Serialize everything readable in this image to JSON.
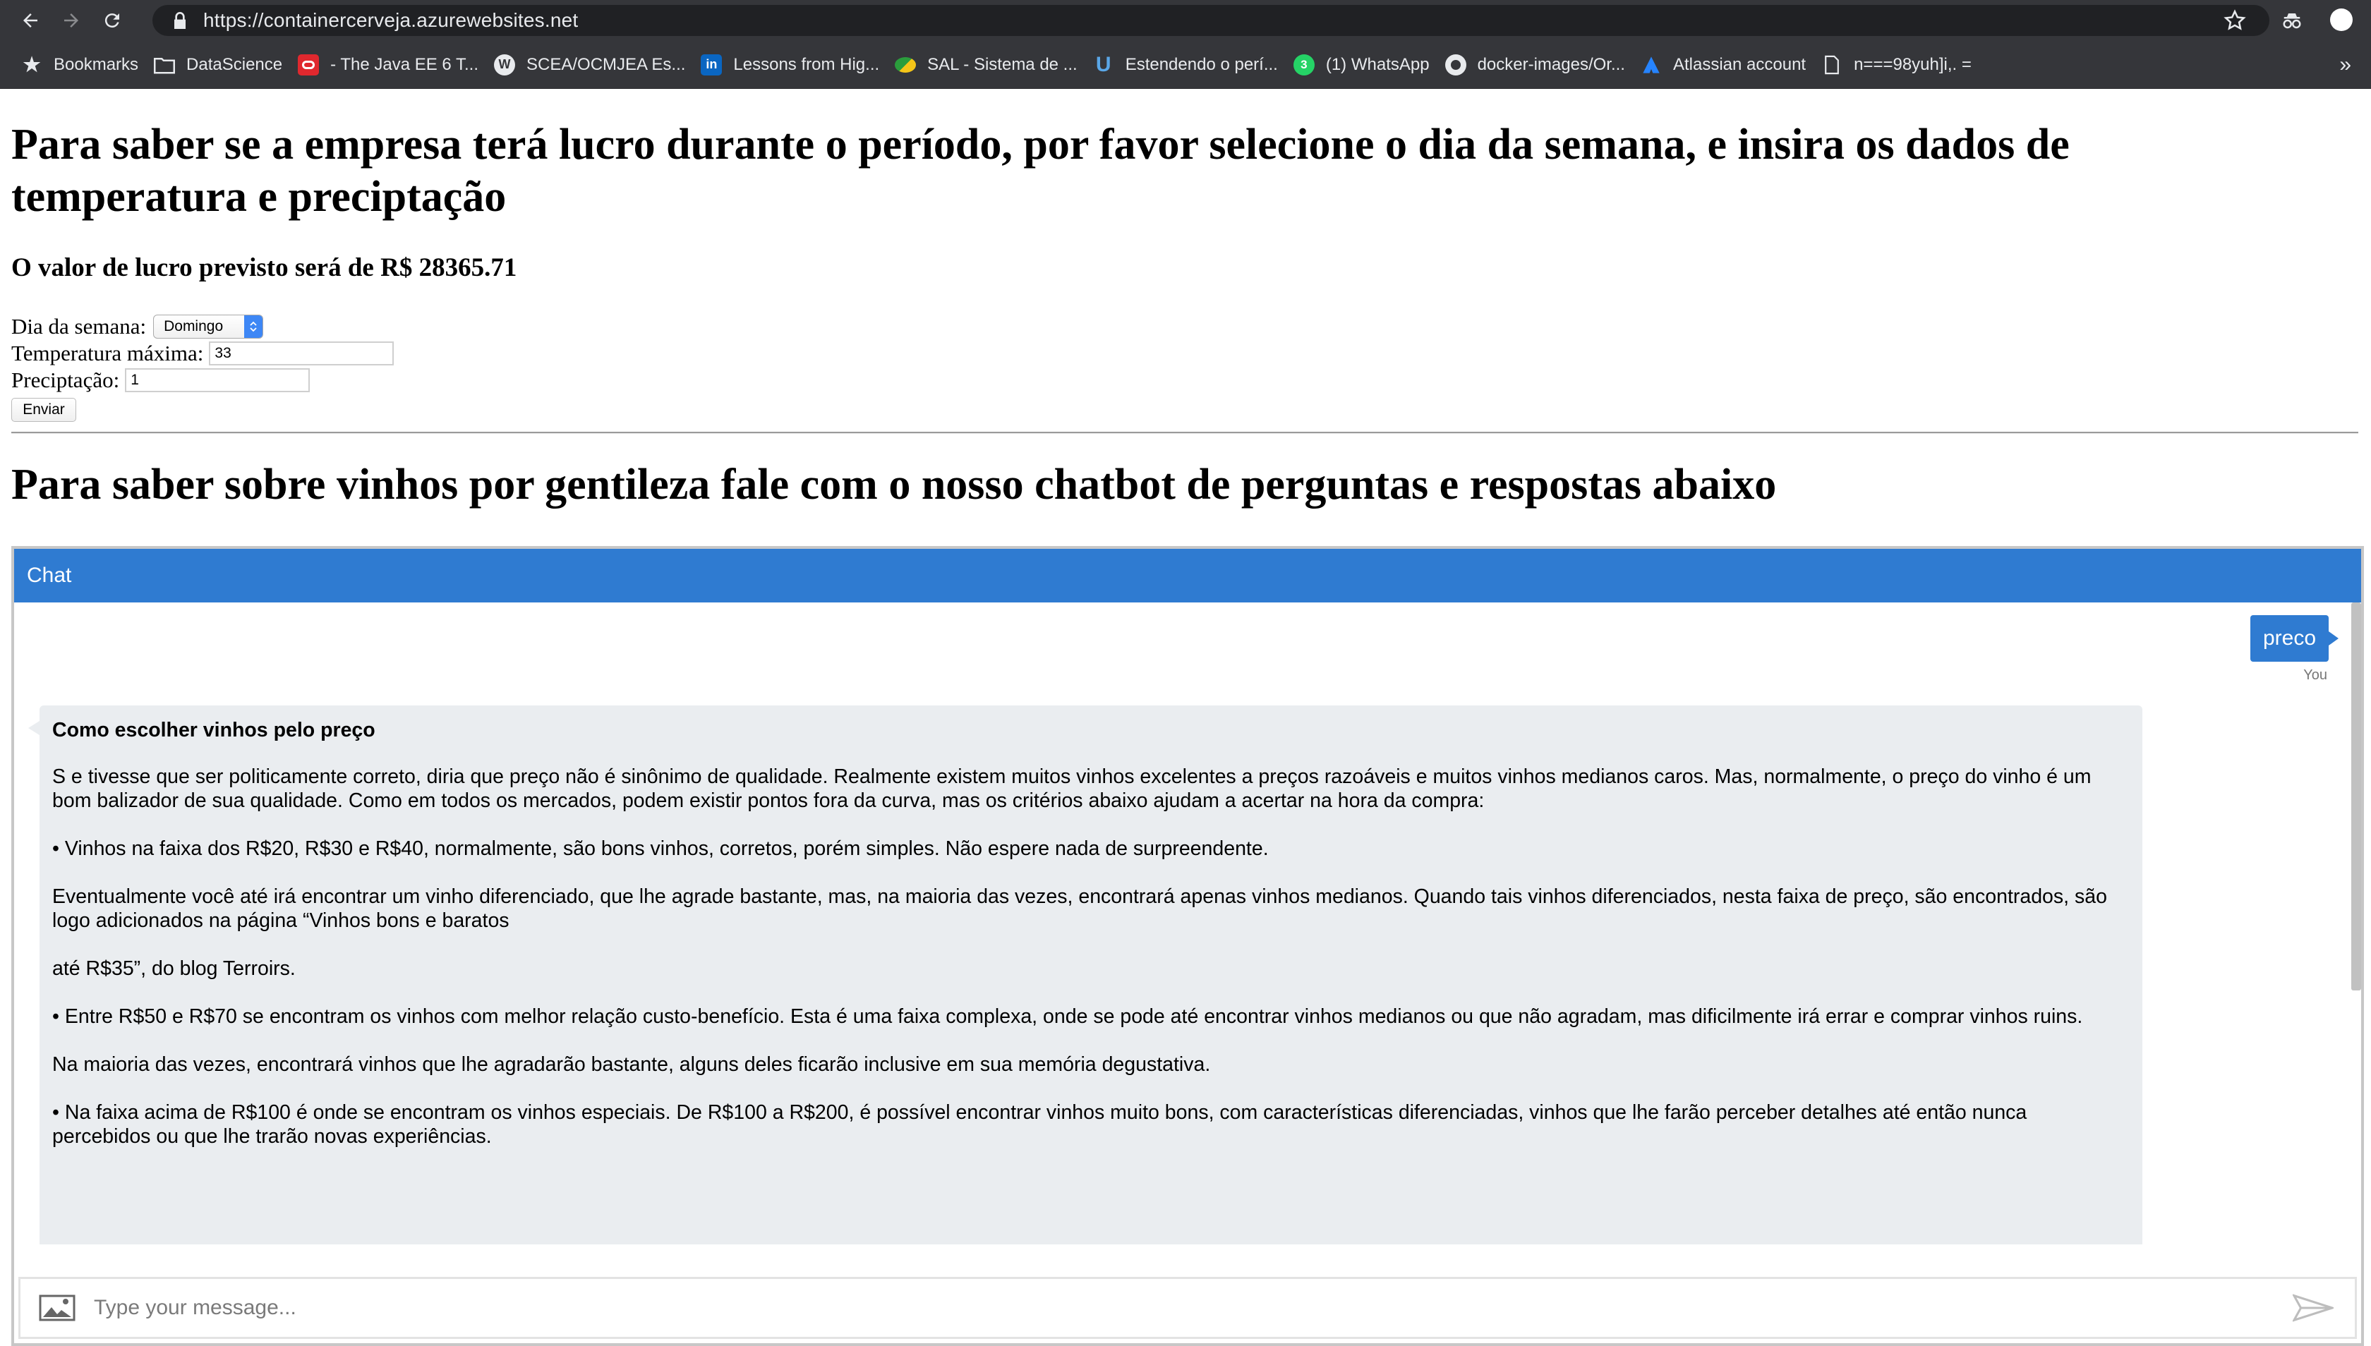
{
  "browser": {
    "url": "https://containercerveja.azurewebsites.net",
    "bookmarks": [
      {
        "label": "Bookmarks",
        "icon": "star-icon"
      },
      {
        "label": "DataScience",
        "icon": "folder-icon"
      },
      {
        "label": "- The Java EE 6 T...",
        "icon": "oracle-icon"
      },
      {
        "label": "SCEA/OCMJEA Es...",
        "icon": "wordpress-icon"
      },
      {
        "label": "Lessons from Hig...",
        "icon": "linkedin-icon"
      },
      {
        "label": "SAL - Sistema de ...",
        "icon": "sal-icon"
      },
      {
        "label": "Estendendo o perí...",
        "icon": "udemy-icon"
      },
      {
        "label": "(1) WhatsApp",
        "icon": "whatsapp-icon"
      },
      {
        "label": "docker-images/Or...",
        "icon": "github-icon"
      },
      {
        "label": "Atlassian account",
        "icon": "atlassian-icon"
      },
      {
        "label": "n===98yuh]i,. =",
        "icon": "page-icon"
      }
    ],
    "more_label": "»"
  },
  "page": {
    "title": "Para saber se a empresa terá lucro durante o período, por favor selecione o dia da semana, e insira os dados de temperatura e preciptação",
    "profit_text": "O valor de lucro previsto será de R$ 28365.71",
    "form": {
      "weekday_label": "Dia da semana:",
      "weekday_value": "Domingo",
      "temperature_label": "Temperatura máxima:",
      "temperature_value": "33",
      "precipitation_label": "Preciptação:",
      "precipitation_value": "1",
      "submit_label": "Enviar"
    },
    "wine_title": "Para saber sobre vinhos por gentileza fale com o nosso chatbot de perguntas e respostas abaixo"
  },
  "chat": {
    "header": "Chat",
    "user_message": "preco",
    "user_label": "You",
    "bot_title": "Como escolher vinhos pelo preço",
    "bot_paragraphs": [
      "S e tivesse que ser politicamente correto, diria que preço não é sinônimo de qualidade. Realmente existem muitos vinhos excelentes a preços razoáveis e muitos vinhos medianos caros. Mas, normalmente, o preço do vinho é um bom balizador de sua qualidade. Como em todos os mercados, podem existir pontos fora da curva, mas os critérios abaixo ajudam a acertar na hora da compra:",
      "• Vinhos na faixa dos R$20, R$30 e R$40, normalmente, são bons vinhos, corretos, porém simples. Não espere nada de surpreendente.",
      "Eventualmente você até irá encontrar um vinho diferenciado, que lhe agrade bastante, mas, na maioria das vezes, encontrará apenas vinhos medianos. Quando tais vinhos diferenciados, nesta faixa de preço, são encontrados, são logo adicionados na página “Vinhos bons e baratos",
      "até R$35”, do blog Terroirs.",
      "• Entre R$50 e R$70 se encontram os vinhos com melhor relação custo-benefício. Esta é uma faixa complexa, onde se pode até encontrar vinhos medianos ou que não agradam, mas dificilmente irá errar e comprar vinhos ruins.",
      "Na maioria das vezes, encontrará vinhos que lhe agradarão bastante, alguns deles ficarão inclusive em sua memória degustativa.",
      "• Na faixa acima de R$100 é onde se encontram os vinhos especiais. De R$100 a R$200, é possível encontrar vinhos muito bons, com características diferenciadas, vinhos que lhe farão perceber detalhes até então nunca percebidos ou que lhe trarão novas experiências."
    ],
    "input_placeholder": "Type your message...",
    "colors": {
      "accent": "#2f7bd1",
      "bot_bubble": "#eaedf0"
    }
  }
}
